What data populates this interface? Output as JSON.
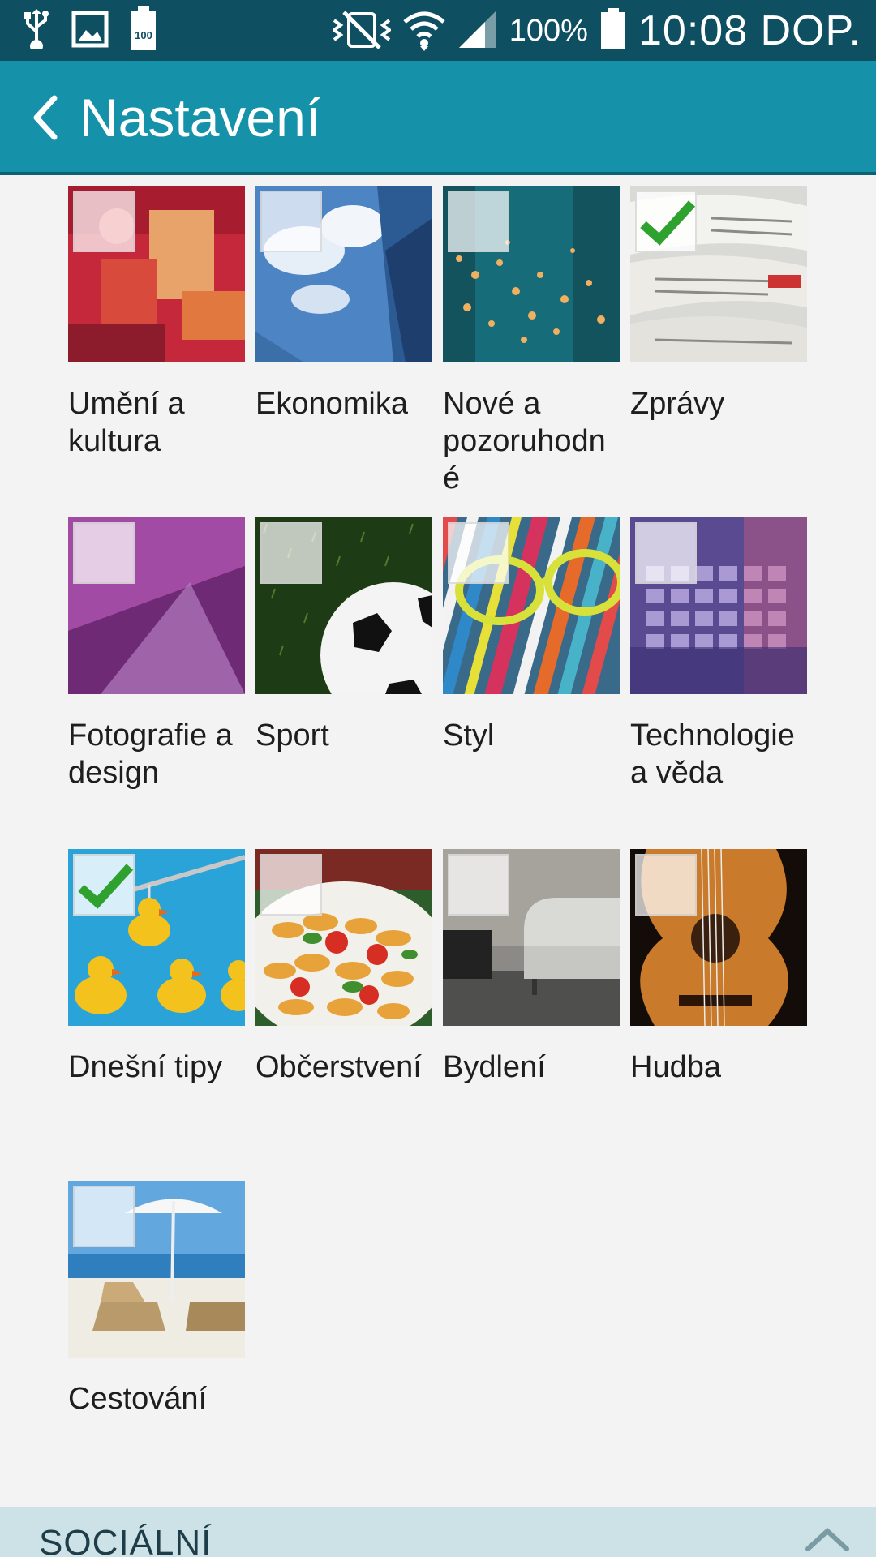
{
  "status_bar": {
    "battery_percent": "100%",
    "time": "10:08 DOP.",
    "battery_level_badge": "100",
    "icons": [
      "usb-icon",
      "gallery-icon",
      "battery-saver-icon",
      "mute-icon",
      "wifi-icon",
      "signal-icon",
      "battery-icon"
    ]
  },
  "header": {
    "title": "Nastavení"
  },
  "categories": [
    {
      "label": "Umění a kultura",
      "checked": false
    },
    {
      "label": "Ekonomika",
      "checked": false
    },
    {
      "label": "Nové a pozoruhodné",
      "checked": false
    },
    {
      "label": "Zprávy",
      "checked": true
    },
    {
      "label": "Fotografie a design",
      "checked": false
    },
    {
      "label": "Sport",
      "checked": false
    },
    {
      "label": "Styl",
      "checked": false
    },
    {
      "label": "Technologie a věda",
      "checked": false
    },
    {
      "label": "Dnešní tipy",
      "checked": true
    },
    {
      "label": "Občerstvení",
      "checked": false
    },
    {
      "label": "Bydlení",
      "checked": false
    },
    {
      "label": "Hudba",
      "checked": false
    },
    {
      "label": "Cestování",
      "checked": false
    }
  ],
  "section": {
    "title": "SOCIÁLNÍ"
  },
  "colors": {
    "status_bar": "#0e4f62",
    "action_bar": "#1592a9",
    "check_green": "#2fa12f",
    "section_bg": "#cde2e7"
  }
}
